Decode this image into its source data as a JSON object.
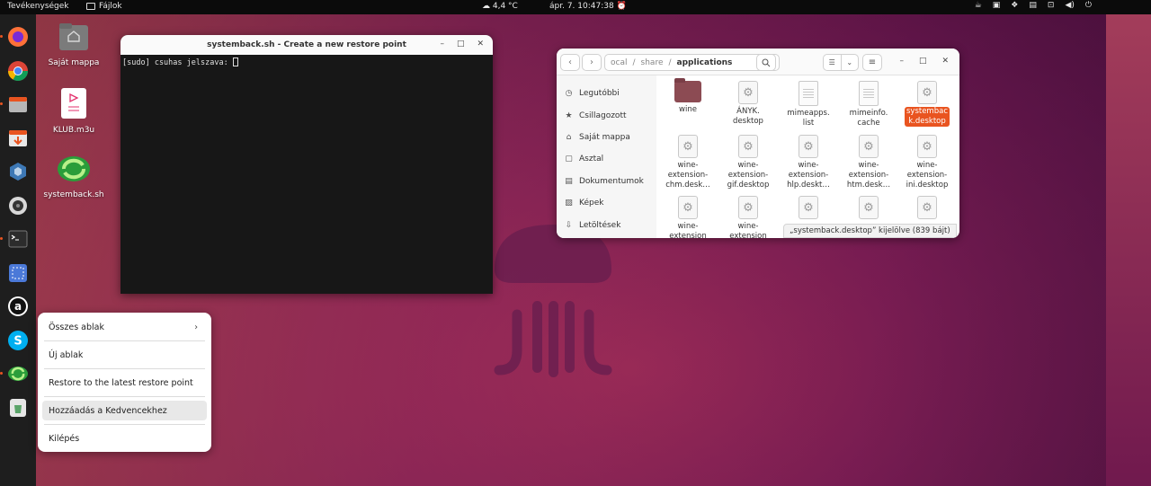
{
  "topbar": {
    "activities": "Tevékenységek",
    "app_name": "Fájlok",
    "weather": "4,4 °C",
    "clock": "ápr. 7.  10:47:38"
  },
  "desktop_icons": [
    {
      "label": "Saját mappa",
      "icon": "home-folder-icon"
    },
    {
      "label": "KLUB.m3u",
      "icon": "playlist-file-icon"
    },
    {
      "label": "systemback.sh",
      "icon": "systemback-icon"
    }
  ],
  "terminal": {
    "title": "systemback.sh - Create a new restore point",
    "prompt": "[sudo] csuhas jelszava: "
  },
  "files": {
    "path": [
      "ocal",
      "share",
      "applications"
    ],
    "sidebar": [
      {
        "label": "Legutóbbi",
        "icon": "clock-icon"
      },
      {
        "label": "Csillagozott",
        "icon": "star-icon"
      },
      {
        "label": "Saját mappa",
        "icon": "home-icon"
      },
      {
        "label": "Asztal",
        "icon": "desktop-icon"
      },
      {
        "label": "Dokumentumok",
        "icon": "document-icon"
      },
      {
        "label": "Képek",
        "icon": "image-icon"
      },
      {
        "label": "Letöltések",
        "icon": "download-icon"
      }
    ],
    "items": [
      {
        "label": "wine",
        "type": "folder"
      },
      {
        "label": "ÁNYK.\ndesktop",
        "type": "gear"
      },
      {
        "label": "mimeapps.\nlist",
        "type": "doc"
      },
      {
        "label": "mimeinfo.\ncache",
        "type": "doc"
      },
      {
        "label": "systembac\nk.desktop",
        "type": "gear",
        "selected": true
      },
      {
        "label": "wine-\nextension-\nchm.desk…",
        "type": "gear"
      },
      {
        "label": "wine-\nextension-\ngif.desktop",
        "type": "gear"
      },
      {
        "label": "wine-\nextension-\nhlp.deskt…",
        "type": "gear"
      },
      {
        "label": "wine-\nextension-\nhtm.desk…",
        "type": "gear"
      },
      {
        "label": "wine-\nextension-\nini.desktop",
        "type": "gear"
      },
      {
        "label": "wine-\nextension",
        "type": "gear"
      },
      {
        "label": "wine-\nextension",
        "type": "gear"
      },
      {
        "label": "",
        "type": "gear"
      },
      {
        "label": "",
        "type": "gear"
      },
      {
        "label": "",
        "type": "gear"
      }
    ],
    "status": "„systemback.desktop” kijelölve (839 bájt)"
  },
  "context_menu": {
    "items": [
      "Összes ablak",
      "Új ablak",
      "Restore to the latest restore point",
      "Hozzáadás a Kedvencekhez",
      "Kilépés"
    ]
  },
  "colors": {
    "accent": "#e95420",
    "topbar": "#0b0b0b",
    "dock": "#1e1e1e"
  }
}
